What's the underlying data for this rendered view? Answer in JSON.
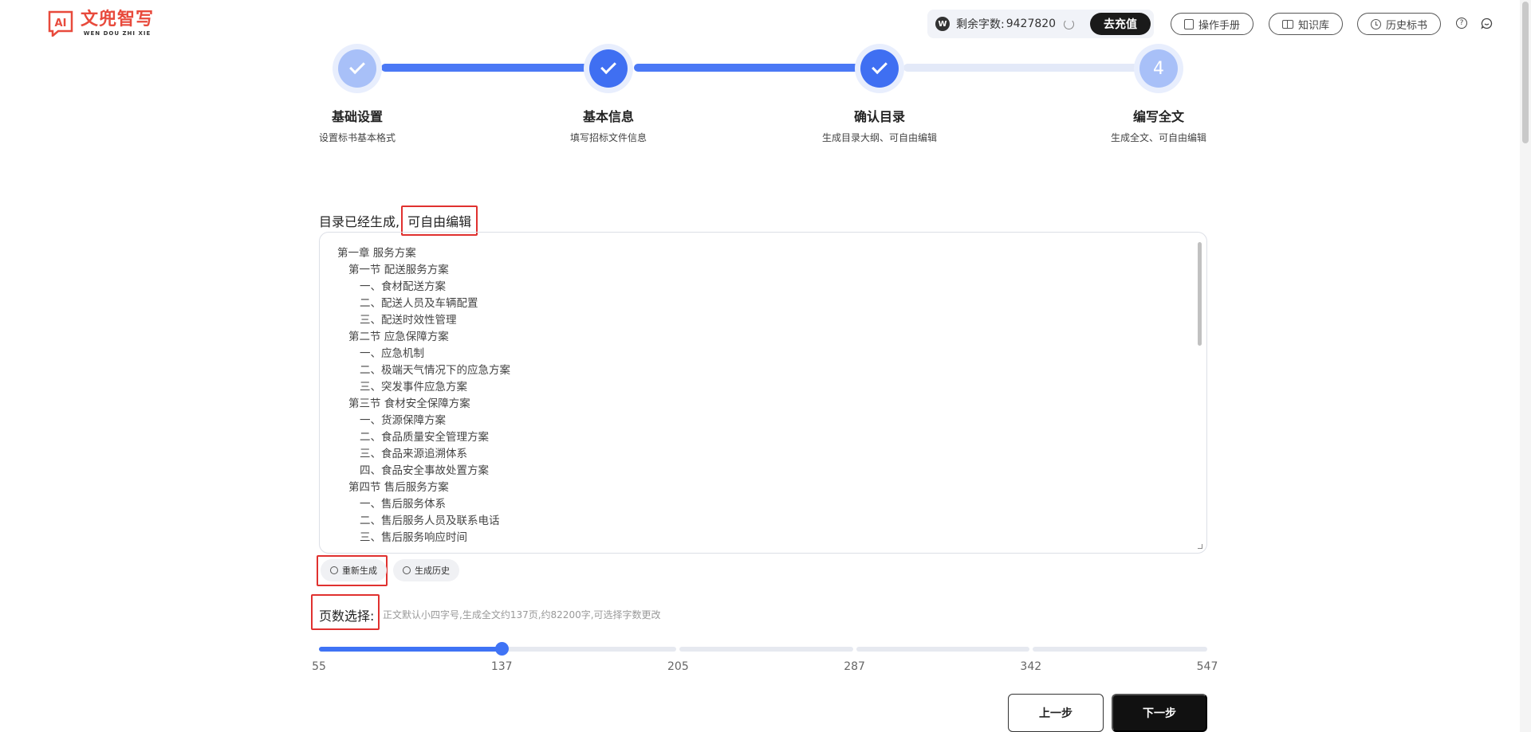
{
  "app": {
    "logo_cn": "文兜智写",
    "logo_en": "WEN DOU ZHI XIE",
    "logo_mark": "AI"
  },
  "header": {
    "credits_label": "剩余字数:",
    "credits_value": "9427820",
    "recharge": "去充值",
    "manual": "操作手册",
    "knowledge": "知识库",
    "history": "历史标书",
    "help": "?"
  },
  "steps": [
    {
      "title": "基础设置",
      "sub": "设置标书基本格式",
      "status": "done"
    },
    {
      "title": "基本信息",
      "sub": "填写招标文件信息",
      "status": "done"
    },
    {
      "title": "确认目录",
      "sub": "生成目录大纲、可自由编辑",
      "status": "current"
    },
    {
      "title": "编写全文",
      "sub": "生成全文、可自由编辑",
      "status": "pending",
      "number": "4"
    }
  ],
  "toc": {
    "title_prefix": "目录已经生成,",
    "title_highlight": "可自由编辑",
    "items": [
      {
        "level": 1,
        "text": "第一章 服务方案"
      },
      {
        "level": 2,
        "text": "第一节 配送服务方案"
      },
      {
        "level": 3,
        "text": "一、食材配送方案"
      },
      {
        "level": 3,
        "text": "二、配送人员及车辆配置"
      },
      {
        "level": 3,
        "text": "三、配送时效性管理"
      },
      {
        "level": 2,
        "text": "第二节 应急保障方案"
      },
      {
        "level": 3,
        "text": "一、应急机制"
      },
      {
        "level": 3,
        "text": "二、极端天气情况下的应急方案"
      },
      {
        "level": 3,
        "text": "三、突发事件应急方案"
      },
      {
        "level": 2,
        "text": "第三节 食材安全保障方案"
      },
      {
        "level": 3,
        "text": "一、货源保障方案"
      },
      {
        "level": 3,
        "text": "二、食品质量安全管理方案"
      },
      {
        "level": 3,
        "text": "三、食品来源追溯体系"
      },
      {
        "level": 3,
        "text": "四、食品安全事故处置方案"
      },
      {
        "level": 2,
        "text": "第四节 售后服务方案"
      },
      {
        "level": 3,
        "text": "一、售后服务体系"
      },
      {
        "level": 3,
        "text": "二、售后服务人员及联系电话"
      },
      {
        "level": 3,
        "text": "三、售后服务响应时间"
      }
    ],
    "regenerate": "重新生成",
    "gen_history": "生成历史"
  },
  "pages": {
    "label": "页数选择:",
    "hint": "正文默认小四字号,生成全文约137页,约82200字,可选择字数更改",
    "selected": 137,
    "ticks": [
      "55",
      "137",
      "205",
      "287",
      "342",
      "547"
    ]
  },
  "actions": {
    "prev": "上一步",
    "next": "下一步"
  },
  "colors": {
    "accent": "#3f73f5",
    "brand": "#e84a3c",
    "highlight_border": "#e0312f"
  }
}
